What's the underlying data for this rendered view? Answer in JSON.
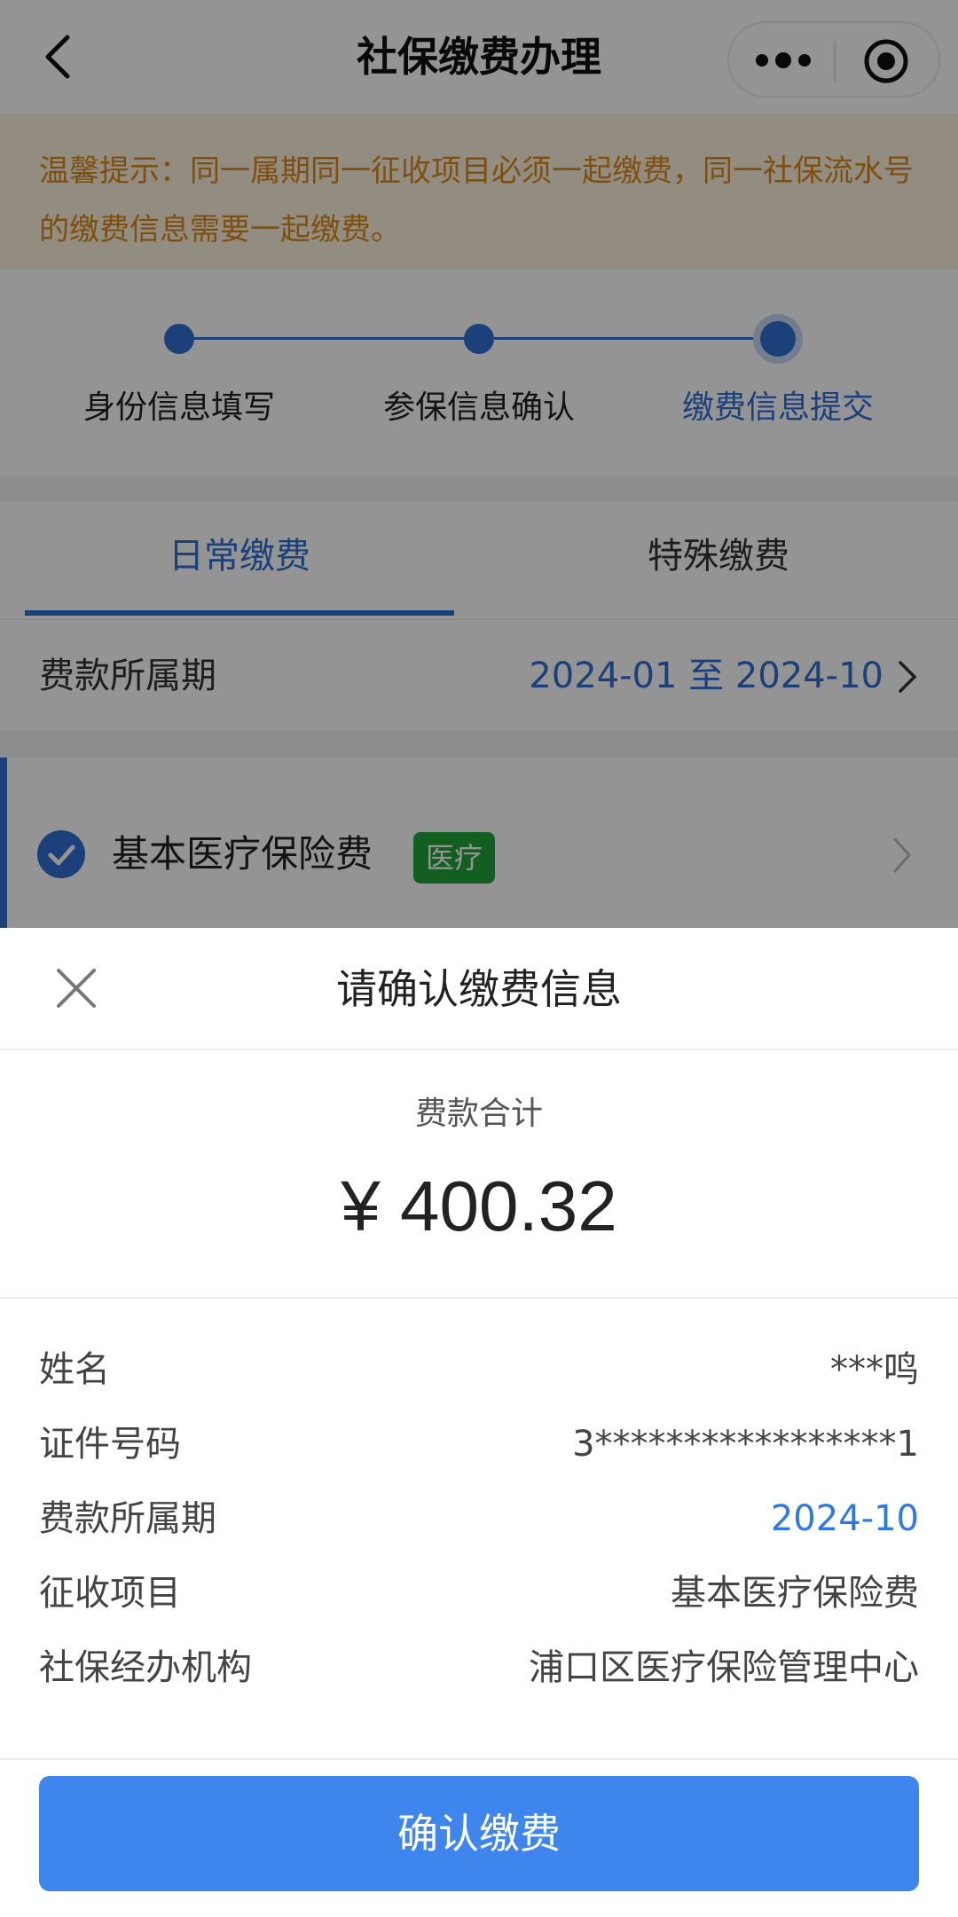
{
  "navbar": {
    "title": "社保缴费办理",
    "back_icon": "chevron-left-icon",
    "more_icon": "more-dots-icon",
    "close_icon": "target-close-icon"
  },
  "tip": {
    "text": "温馨提示：同一属期同一征收项目必须一起缴费，同一社保流水号的缴费信息需要一起缴费。"
  },
  "steps": [
    {
      "label": "身份信息填写",
      "active": false
    },
    {
      "label": "参保信息确认",
      "active": false
    },
    {
      "label": "缴费信息提交",
      "active": true
    }
  ],
  "tabs": [
    {
      "label": "日常缴费",
      "active": true
    },
    {
      "label": "特殊缴费",
      "active": false
    }
  ],
  "period": {
    "label": "费款所属期",
    "value": "2024-01 至 2024-10"
  },
  "item": {
    "label": "基本医疗保险费",
    "tag": "医疗",
    "checked": true
  },
  "sheet": {
    "title": "请确认缴费信息",
    "total_label": "费款合计",
    "total_amount": "¥ 400.32",
    "details": [
      {
        "label": "姓名",
        "value": "***鸣"
      },
      {
        "label": "证件号码",
        "value": "3*****************1"
      },
      {
        "label": "费款所属期",
        "value": "2024-10"
      },
      {
        "label": "征收项目",
        "value": "基本医疗保险费"
      },
      {
        "label": "社保经办机构",
        "value": "浦口区医疗保险管理中心"
      }
    ],
    "confirm_button": "确认缴费"
  },
  "colors": {
    "accent": "#2f6fd3",
    "button": "#3e86ee",
    "tip_text": "#d98a1c",
    "tip_bg": "#fdf1dc",
    "tag_green": "#22a33a"
  }
}
